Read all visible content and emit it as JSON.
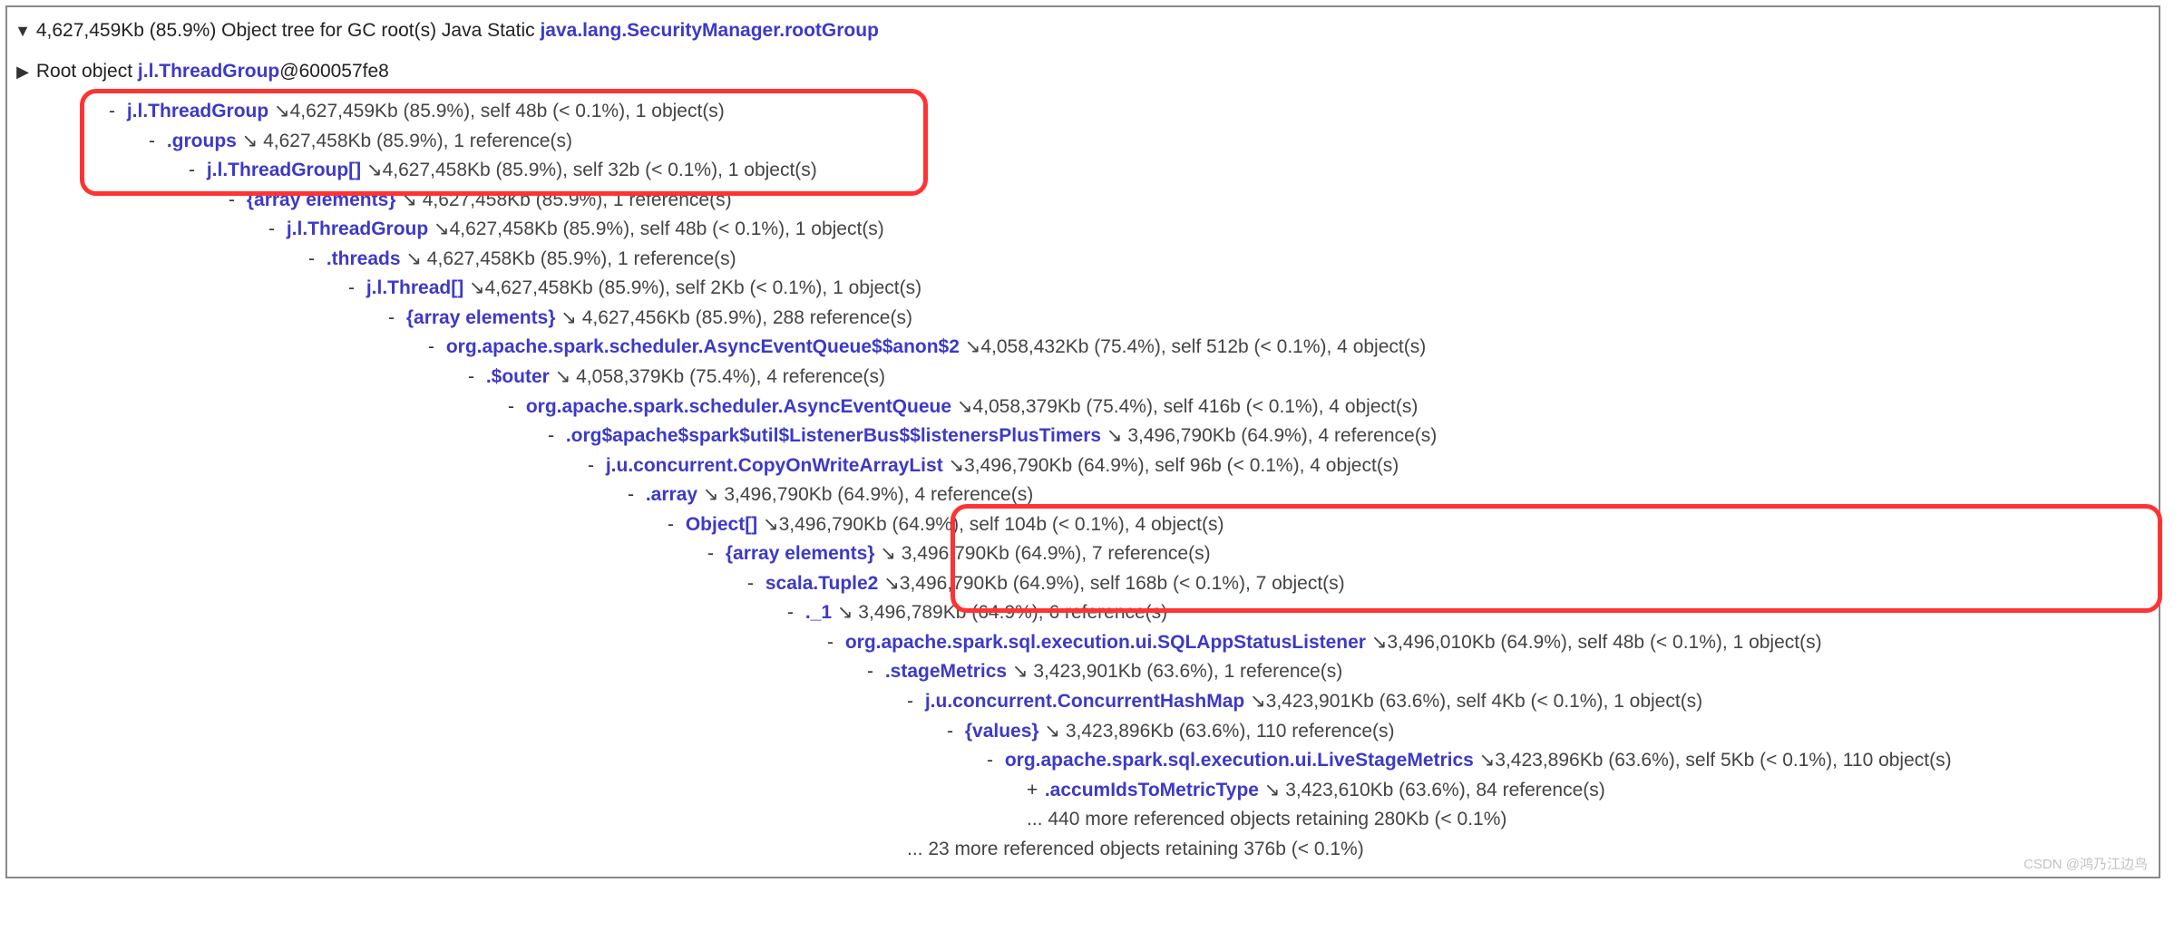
{
  "header": {
    "size": "4,627,459Kb",
    "percent": "(85.9%)",
    "label": "Object tree for GC root(s) Java Static",
    "root": "java.lang.SecurityManager.rootGroup"
  },
  "root_row": {
    "label": "Root object",
    "class": "j.l.ThreadGroup",
    "id": "@600057fe8"
  },
  "tree": [
    {
      "indent": 1,
      "toggle": "-",
      "name_class": "link",
      "name": "j.l.ThreadGroup",
      "detail": " ↘4,627,459Kb (85.9%), self 48b (< 0.1%), 1 object(s)"
    },
    {
      "indent": 2,
      "toggle": "-",
      "name_class": "link",
      "name": ".groups",
      "detail": " ↘ 4,627,458Kb (85.9%), 1 reference(s)"
    },
    {
      "indent": 3,
      "toggle": "-",
      "name_class": "link",
      "name": "j.l.ThreadGroup[]",
      "detail": " ↘4,627,458Kb (85.9%), self 32b (< 0.1%), 1 object(s)"
    },
    {
      "indent": 4,
      "toggle": "-",
      "name_class": "link",
      "name": "{array elements}",
      "detail": " ↘ 4,627,458Kb (85.9%), 1 reference(s)"
    },
    {
      "indent": 5,
      "toggle": "-",
      "name_class": "link",
      "name": "j.l.ThreadGroup",
      "detail": " ↘4,627,458Kb (85.9%), self 48b (< 0.1%), 1 object(s)"
    },
    {
      "indent": 6,
      "toggle": "-",
      "name_class": "link",
      "name": ".threads",
      "detail": " ↘ 4,627,458Kb (85.9%), 1 reference(s)"
    },
    {
      "indent": 7,
      "toggle": "-",
      "name_class": "link",
      "name": "j.l.Thread[]",
      "detail": " ↘4,627,458Kb (85.9%), self 2Kb (< 0.1%), 1 object(s)"
    },
    {
      "indent": 8,
      "toggle": "-",
      "name_class": "link",
      "name": "{array elements}",
      "detail": " ↘ 4,627,456Kb (85.9%), 288 reference(s)"
    },
    {
      "indent": 9,
      "toggle": "-",
      "name_class": "link",
      "name": "org.apache.spark.scheduler.AsyncEventQueue$$anon$2",
      "detail": " ↘4,058,432Kb (75.4%), self 512b (< 0.1%), 4 object(s)"
    },
    {
      "indent": 10,
      "toggle": "-",
      "name_class": "link",
      "name": ".$outer",
      "detail": " ↘ 4,058,379Kb (75.4%), 4 reference(s)"
    },
    {
      "indent": 11,
      "toggle": "-",
      "name_class": "link",
      "name": "org.apache.spark.scheduler.AsyncEventQueue",
      "detail": " ↘4,058,379Kb (75.4%), self 416b (< 0.1%), 4 object(s)"
    },
    {
      "indent": 12,
      "toggle": "-",
      "name_class": "link",
      "name": ".org$apache$spark$util$ListenerBus$$listenersPlusTimers",
      "detail": " ↘ 3,496,790Kb (64.9%), 4 reference(s)"
    },
    {
      "indent": 13,
      "toggle": "-",
      "name_class": "link",
      "name": "j.u.concurrent.CopyOnWriteArrayList",
      "detail": " ↘3,496,790Kb (64.9%), self 96b (< 0.1%), 4 object(s)"
    },
    {
      "indent": 14,
      "toggle": "-",
      "name_class": "link",
      "name": ".array",
      "detail": " ↘ 3,496,790Kb (64.9%), 4 reference(s)"
    },
    {
      "indent": 15,
      "toggle": "-",
      "name_class": "link",
      "name": "Object[]",
      "detail": " ↘3,496,790Kb (64.9%), self 104b (< 0.1%), 4 object(s)"
    },
    {
      "indent": 16,
      "toggle": "-",
      "name_class": "link",
      "name": "{array elements}",
      "detail": " ↘ 3,496,790Kb (64.9%), 7 reference(s)"
    },
    {
      "indent": 17,
      "toggle": "-",
      "name_class": "link",
      "name": "scala.Tuple2",
      "detail": " ↘3,496,790Kb (64.9%), self 168b (< 0.1%), 7 object(s)"
    },
    {
      "indent": 18,
      "toggle": "-",
      "name_class": "link",
      "name": "._1",
      "detail": " ↘ 3,496,789Kb (64.9%), 6 reference(s)"
    },
    {
      "indent": 19,
      "toggle": "-",
      "name_class": "link",
      "name": "org.apache.spark.sql.execution.ui.SQLAppStatusListener",
      "detail": " ↘3,496,010Kb (64.9%), self 48b (< 0.1%), 1 object(s)"
    },
    {
      "indent": 20,
      "toggle": "-",
      "name_class": "link",
      "name": ".stageMetrics",
      "detail": " ↘ 3,423,901Kb (63.6%), 1 reference(s)"
    },
    {
      "indent": 21,
      "toggle": "-",
      "name_class": "link",
      "name": "j.u.concurrent.ConcurrentHashMap",
      "detail": " ↘3,423,901Kb (63.6%), self 4Kb (< 0.1%), 1 object(s)"
    },
    {
      "indent": 22,
      "toggle": "-",
      "name_class": "link",
      "name": "{values}",
      "detail": " ↘ 3,423,896Kb (63.6%), 110 reference(s)"
    },
    {
      "indent": 23,
      "toggle": "-",
      "name_class": "link",
      "name": "org.apache.spark.sql.execution.ui.LiveStageMetrics",
      "detail": " ↘3,423,896Kb (63.6%), self 5Kb (< 0.1%), 110 object(s)"
    },
    {
      "indent": 24,
      "toggle": "+",
      "name_class": "link",
      "name": ".accumIdsToMetricType",
      "detail": " ↘ 3,423,610Kb (63.6%), 84 reference(s)"
    },
    {
      "indent": 24,
      "toggle": "",
      "name_class": "",
      "name": "",
      "detail": "... 440 more referenced objects retaining 280Kb (< 0.1%)"
    },
    {
      "indent": 21,
      "toggle": "",
      "name_class": "",
      "name": "",
      "detail": "... 23 more referenced objects retaining 376b (< 0.1%)"
    }
  ],
  "watermark": "CSDN @鸿乃江边鸟"
}
